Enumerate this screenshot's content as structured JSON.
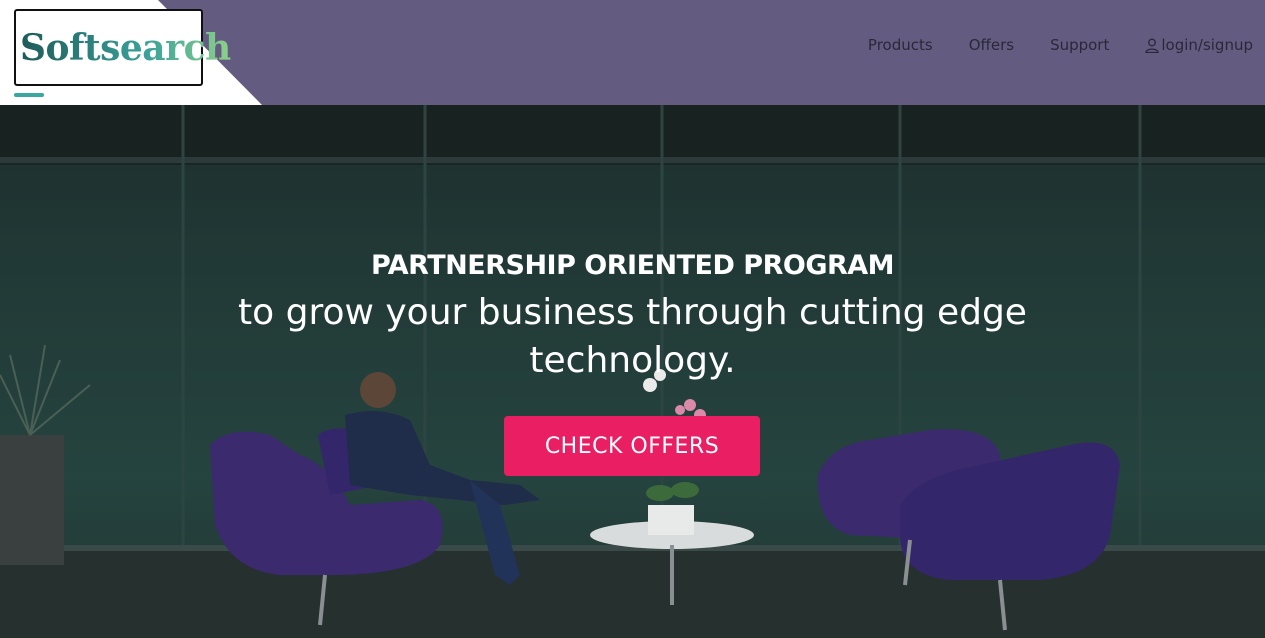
{
  "brand": {
    "logo_text": "Softsearch"
  },
  "nav": {
    "items": [
      {
        "label": "Products"
      },
      {
        "label": "Offers"
      },
      {
        "label": "Support"
      },
      {
        "label": "login/signup",
        "icon": "user-icon"
      }
    ]
  },
  "hero": {
    "kicker": "PARTNERSHIP ORIENTED PROGRAM",
    "title": "to grow your business through cutting edge technology.",
    "cta_label": "CHECK OFFERS"
  },
  "colors": {
    "header_bg": "#645c80",
    "cta_bg": "#e91e63",
    "logo_gradient": [
      "#1d5b5a",
      "#3aa19a",
      "#8fd18a"
    ]
  }
}
